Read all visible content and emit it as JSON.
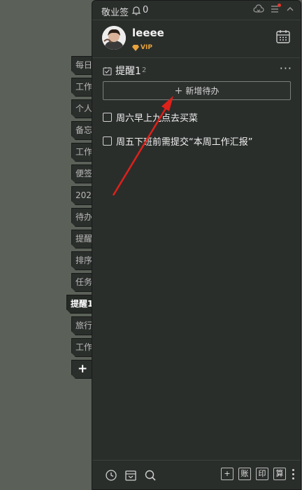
{
  "side_tabs": [
    {
      "label": "每日"
    },
    {
      "label": "工作"
    },
    {
      "label": "个人"
    },
    {
      "label": "备忘"
    },
    {
      "label": "工作"
    },
    {
      "label": "便签"
    },
    {
      "label": "202"
    },
    {
      "label": "待办"
    },
    {
      "label": "提醒"
    },
    {
      "label": "排序"
    },
    {
      "label": "任务"
    },
    {
      "label": "提醒1",
      "active": true
    },
    {
      "label": "旅行"
    },
    {
      "label": "工作"
    },
    {
      "label": "+"
    }
  ],
  "titlebar": {
    "app_name": "敬业签",
    "notification_count": "0",
    "icons": [
      "bell-icon",
      "cloud-sync-icon",
      "menu-icon",
      "collapse-icon"
    ]
  },
  "profile": {
    "username": "leeee",
    "vip_label": "VIP",
    "calendar_icon": "calendar-icon"
  },
  "list": {
    "title": "提醒1",
    "count": "2",
    "more_label": "···",
    "add_label": "新增待办",
    "add_icon": "+"
  },
  "todos": [
    {
      "text": "周六早上九点去买菜",
      "done": false
    },
    {
      "text": "周五下班前需提交“本周工作汇报”",
      "done": false
    }
  ],
  "footer": {
    "left_icons": [
      "clock-icon",
      "archive-icon",
      "search-icon"
    ],
    "add_label": "+",
    "btn_account": "账",
    "btn_print": "印",
    "btn_calc": "算"
  },
  "colors": {
    "background": "#5b6158",
    "panel": "#2a2e2b",
    "accent_vip": "#e8a33c",
    "arrow": "#e0201a",
    "notify_dot": "#e03a2f"
  }
}
